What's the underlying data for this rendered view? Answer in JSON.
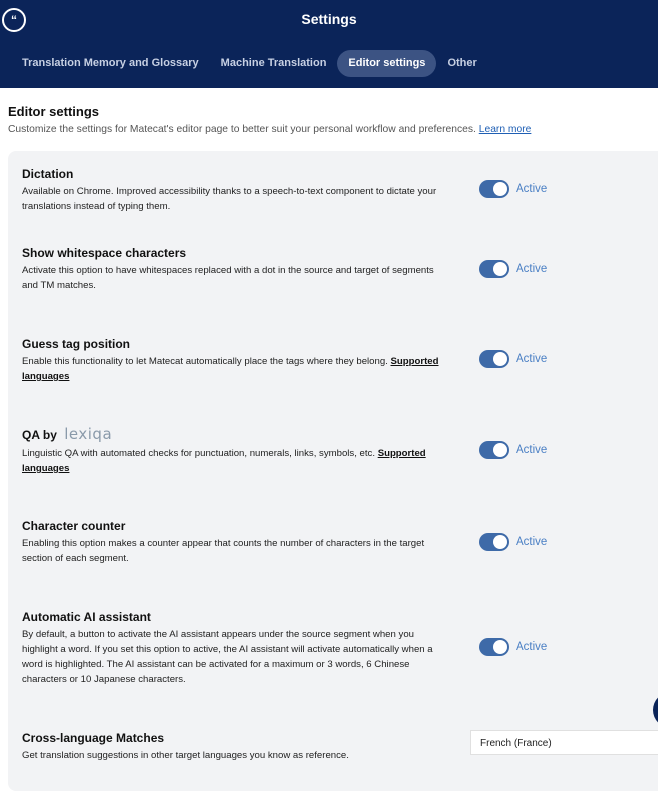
{
  "header": {
    "logo_glyph": "“",
    "title": "Settings",
    "tabs": [
      {
        "label": "Translation Memory and Glossary"
      },
      {
        "label": "Machine Translation"
      },
      {
        "label": "Editor settings"
      },
      {
        "label": "Other"
      }
    ]
  },
  "section": {
    "title": "Editor settings",
    "description": "Customize the settings for Matecat's editor page to better suit your personal workflow and preferences.",
    "learn_more": "Learn more"
  },
  "settings": [
    {
      "title": "Dictation",
      "desc": "Available on Chrome. Improved accessibility thanks to a speech-to-text component to dictate your translations instead of typing them.",
      "status": "Active"
    },
    {
      "title": "Show whitespace characters",
      "desc": "Activate this option to have whitespaces replaced with a dot in the source and target of segments and TM matches.",
      "status": "Active"
    },
    {
      "title": "Guess tag position",
      "desc": "Enable this functionality to let Matecat automatically place the tags where they belong.",
      "link": "Supported languages",
      "status": "Active"
    },
    {
      "title": "QA by",
      "logo_text": "lexiqa",
      "desc": "Linguistic QA with automated checks for punctuation, numerals, links, symbols, etc.",
      "link": "Supported languages",
      "status": "Active"
    },
    {
      "title": "Character counter",
      "desc": "Enabling this option makes a counter appear that counts the number of characters in the target section of each segment.",
      "status": "Active"
    },
    {
      "title": "Automatic AI assistant",
      "desc": "By default, a button to activate the AI assistant appears under the source segment when you highlight a word. If you set this option to active, the AI assistant will activate automatically when a word is highlighted. The AI assistant can be activated for a maximum or 3 words, 6 Chinese characters or 10 Japanese characters.",
      "status": "Active"
    },
    {
      "title": "Cross-language Matches",
      "desc": "Get translation suggestions in other target languages you know as reference.",
      "select_value": "French (France)"
    }
  ]
}
